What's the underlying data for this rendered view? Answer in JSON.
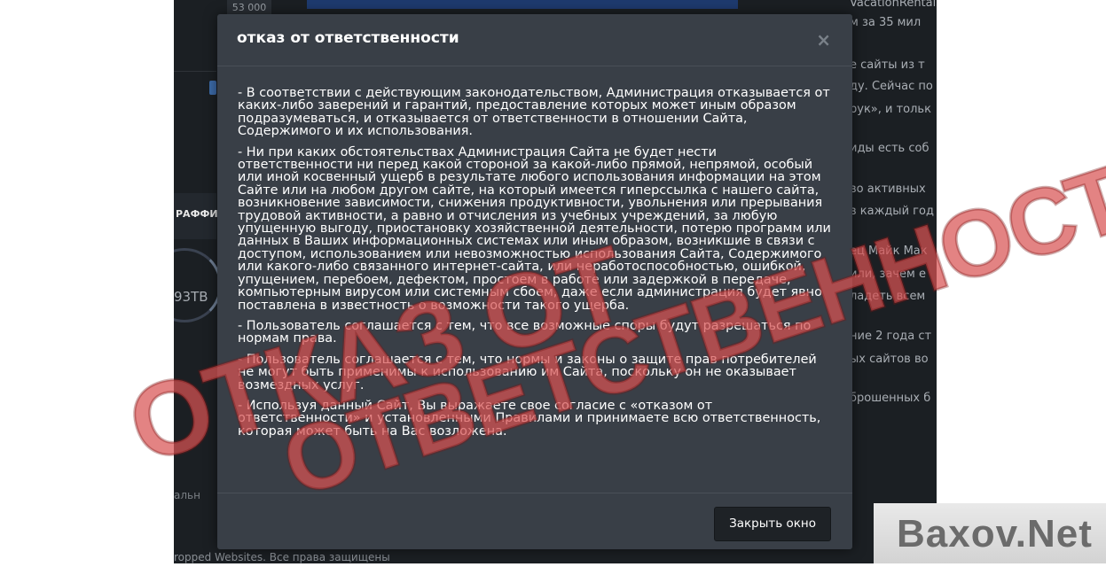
{
  "background": {
    "top_count": "53 000",
    "stat_label": "РАФФИ",
    "ring_value": "93ТВ",
    "footer": "ropped Websites. Все права защищены",
    "small_text": "альн",
    "right_column": [
      "VacationRentals.com. В",
      "м за 35 мил",
      "е сайты из т",
      "ду. Сейчас по",
      "рук», и тольк",
      "иды есть соб",
      "во активных",
      "в каждый год",
      "ец Майк Мак",
      "или, зачем е",
      "ладеть всем",
      "ние 2 года ст",
      "ых сайтов во",
      "брошенных б"
    ]
  },
  "modal": {
    "title": "отказ от ответственности",
    "close_symbol": "×",
    "paragraphs": [
      "- В соответствии с действующим законодательством, Администрация отказывается от каких-либо заверений и гарантий, предоставление которых может иным образом подразумеваться, и отказывается от ответственности в отношении Сайта, Содержимого и их использования.",
      "- Ни при каких обстоятельствах Администрация Сайта не будет нести ответственности ни перед какой стороной за какой-либо прямой, непрямой, особый или иной косвенный ущерб в результате любого использования информации на этом Сайте или на любом другом сайте, на который имеется гиперссылка с нашего сайта, возникновение зависимости, снижения продуктивности, увольнения или прерывания трудовой активности, а равно и отчисления из учебных учреждений, за любую упущенную выгоду, приостановку хозяйственной деятельности, потерю программ или данных в Ваших информационных системах или иным образом, возникшие в связи с доступом, использованием или невозможностью использования Сайта, Содержимого или какого-либо связанного интернет-сайта, или неработоспособностью, ошибкой, упущением, перебоем, дефектом, простоем в работе или задержкой в передаче, компьютерным вирусом или системным сбоем, даже если администрация будет явно поставлена в известность о возможности такого ущерба.",
      "- Пользователь соглашается с тем, что все возможные споры будут разрешаться по нормам права.",
      "- Пользователь соглашается с тем, что нормы и законы о защите прав потребителей не могут быть применимы к использованию им Сайта, поскольку он не оказывает возмездных услуг.",
      "- Используя данный Сайт, Вы выражаете свое согласие с «отказом от ответственности» и установленными Правилами и принимаете всю ответственность, которая может быть на Вас возложена."
    ],
    "close_button": "Закрыть окно"
  },
  "stamp": {
    "line1": "ОТКАЗ ОТ",
    "line2": "ОТВЕТСТВЕННОСТИ"
  },
  "watermark": "Baxov.Net",
  "colors": {
    "modal_bg": "#393f47",
    "page_bg": "#1b1f23",
    "stamp": "#d85353"
  }
}
